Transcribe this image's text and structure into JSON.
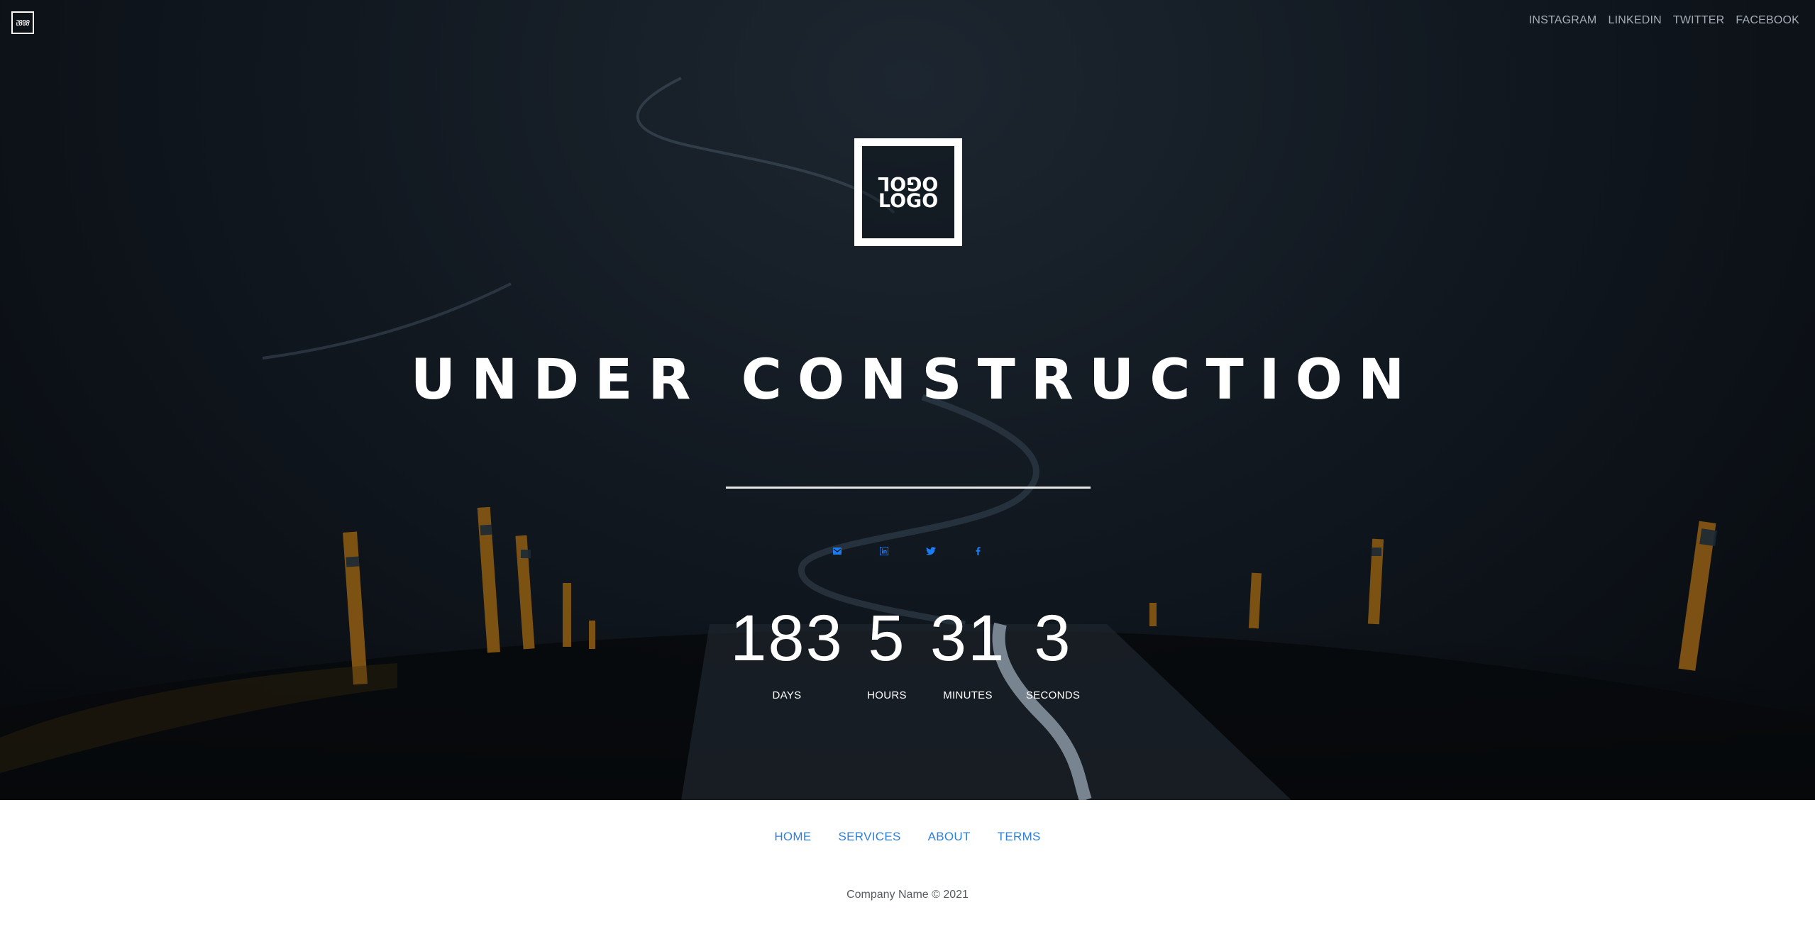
{
  "header": {
    "logo": {
      "line1": "OGOL",
      "line2": "LOGO"
    },
    "social_links": [
      "INSTAGRAM",
      "LINKEDIN",
      "TWITTER",
      "FACEBOOK"
    ]
  },
  "hero": {
    "logo": {
      "line1": "OGOL",
      "line2": "LOGO"
    },
    "title": "UNDER CONSTRUCTION",
    "icons": [
      "email-icon",
      "linkedin-icon",
      "twitter-icon",
      "facebook-icon"
    ],
    "icon_color": "#1d7bf2"
  },
  "countdown": {
    "days": {
      "value": "183",
      "label": "DAYS"
    },
    "hours": {
      "value": "5",
      "label": "HOURS"
    },
    "minutes": {
      "value": "31",
      "label": "MINUTES"
    },
    "seconds": {
      "value": "3",
      "label": "SECONDS"
    }
  },
  "footer": {
    "nav": [
      "HOME",
      "SERVICES",
      "ABOUT",
      "TERMS"
    ],
    "copyright": "Company Name © 2021",
    "link_color": "#2f80d8"
  }
}
